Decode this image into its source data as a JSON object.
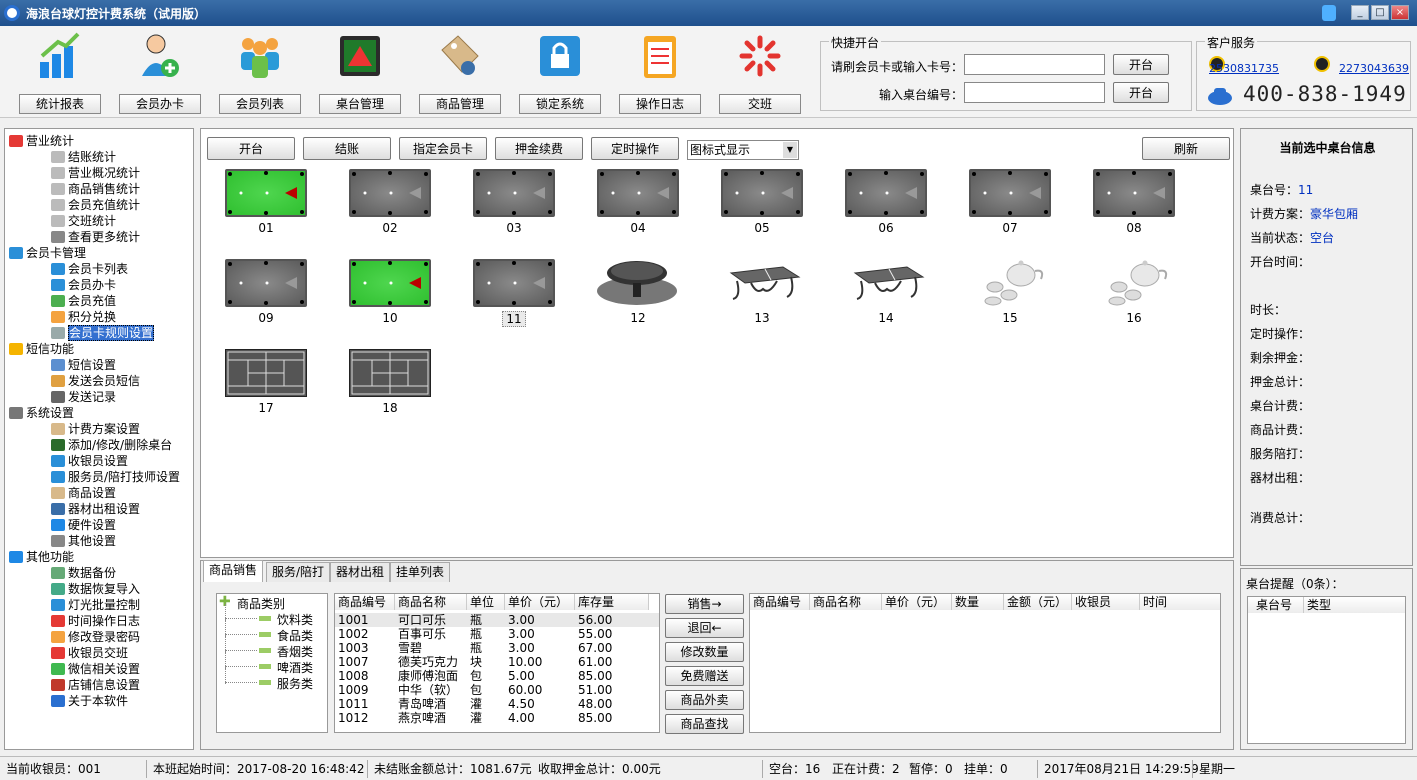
{
  "window": {
    "title": "海浪台球灯控计费系统（试用版）",
    "min": "_",
    "max": "□",
    "close": "×"
  },
  "toolbar": {
    "buttons": [
      {
        "label": "统计报表",
        "icon": "bar-chart-icon"
      },
      {
        "label": "会员办卡",
        "icon": "add-member-icon"
      },
      {
        "label": "会员列表",
        "icon": "members-icon"
      },
      {
        "label": "桌台管理",
        "icon": "billiard-rack-icon"
      },
      {
        "label": "商品管理",
        "icon": "price-tag-icon"
      },
      {
        "label": "锁定系统",
        "icon": "lock-icon"
      },
      {
        "label": "操作日志",
        "icon": "clipboard-icon"
      },
      {
        "label": "交班",
        "icon": "spinner-icon"
      }
    ]
  },
  "quick_open": {
    "title": "快捷开台",
    "card_label": "请刷会员卡或输入卡号：",
    "table_label": "输入桌台编号：",
    "open_button": "开台",
    "open_button2": "开台"
  },
  "service": {
    "title": "客户服务",
    "qq1": "2530831735",
    "qq2": "2273043639",
    "phone": "400-838-1949"
  },
  "tree": [
    {
      "label": "营业统计",
      "level": 0,
      "icon": "pie-icon"
    },
    {
      "label": "结账统计",
      "level": 1,
      "icon": "doc-icon"
    },
    {
      "label": "营业概况统计",
      "level": 1,
      "icon": "doc-icon"
    },
    {
      "label": "商品销售统计",
      "level": 1,
      "icon": "doc-icon"
    },
    {
      "label": "会员充值统计",
      "level": 1,
      "icon": "doc-icon"
    },
    {
      "label": "交班统计",
      "level": 1,
      "icon": "doc-icon"
    },
    {
      "label": "查看更多统计",
      "level": 1,
      "icon": "more-icon"
    },
    {
      "label": "会员卡管理",
      "level": 0,
      "icon": "user-icon"
    },
    {
      "label": "会员卡列表",
      "level": 1,
      "icon": "user-icon"
    },
    {
      "label": "会员办卡",
      "level": 1,
      "icon": "user-add-icon"
    },
    {
      "label": "会员充值",
      "level": 1,
      "icon": "recharge-icon"
    },
    {
      "label": "积分兑换",
      "level": 1,
      "icon": "gift-icon"
    },
    {
      "label": "会员卡规则设置",
      "level": 1,
      "icon": "rule-icon",
      "selected": true
    },
    {
      "label": "短信功能",
      "level": 0,
      "icon": "mail-icon"
    },
    {
      "label": "短信设置",
      "level": 1,
      "icon": "sms-icon"
    },
    {
      "label": "发送会员短信",
      "level": 1,
      "icon": "send-icon"
    },
    {
      "label": "发送记录",
      "level": 1,
      "icon": "list-icon"
    },
    {
      "label": "系统设置",
      "level": 0,
      "icon": "gear-icon"
    },
    {
      "label": "计费方案设置",
      "level": 1,
      "icon": "tag-icon"
    },
    {
      "label": "添加/修改/删除桌台",
      "level": 1,
      "icon": "table-icon"
    },
    {
      "label": "收银员设置",
      "level": 1,
      "icon": "user-icon"
    },
    {
      "label": "服务员/陪打技师设置",
      "level": 1,
      "icon": "user-icon"
    },
    {
      "label": "商品设置",
      "level": 1,
      "icon": "tag-icon"
    },
    {
      "label": "器材出租设置",
      "level": 1,
      "icon": "link-icon"
    },
    {
      "label": "硬件设置",
      "level": 1,
      "icon": "hardware-icon"
    },
    {
      "label": "其他设置",
      "level": 1,
      "icon": "tools-icon"
    },
    {
      "label": "其他功能",
      "level": 0,
      "icon": "cube-icon"
    },
    {
      "label": "数据备份",
      "level": 1,
      "icon": "backup-icon"
    },
    {
      "label": "数据恢复导入",
      "level": 1,
      "icon": "restore-icon"
    },
    {
      "label": "灯光批量控制",
      "level": 1,
      "icon": "bulb-icon"
    },
    {
      "label": "时间操作日志",
      "level": 1,
      "icon": "clock-icon"
    },
    {
      "label": "修改登录密码",
      "level": 1,
      "icon": "key-icon"
    },
    {
      "label": "收银员交班",
      "level": 1,
      "icon": "spinner-icon"
    },
    {
      "label": "微信相关设置",
      "level": 1,
      "icon": "wechat-icon"
    },
    {
      "label": "店铺信息设置",
      "level": 1,
      "icon": "shop-icon"
    },
    {
      "label": "关于本软件",
      "level": 1,
      "icon": "info-icon"
    }
  ],
  "actions": {
    "open": "开台",
    "checkout": "结账",
    "assign_card": "指定会员卡",
    "deposit": "押金续费",
    "timer": "定时操作",
    "view_mode": "图标式显示",
    "refresh": "刷新"
  },
  "tables": [
    {
      "no": "01",
      "type": "billiard",
      "active": true
    },
    {
      "no": "02",
      "type": "billiard"
    },
    {
      "no": "03",
      "type": "billiard"
    },
    {
      "no": "04",
      "type": "billiard"
    },
    {
      "no": "05",
      "type": "billiard"
    },
    {
      "no": "06",
      "type": "billiard"
    },
    {
      "no": "07",
      "type": "billiard"
    },
    {
      "no": "08",
      "type": "billiard"
    },
    {
      "no": "09",
      "type": "billiard"
    },
    {
      "no": "10",
      "type": "billiard",
      "active": true
    },
    {
      "no": "11",
      "type": "billiard",
      "selected": true
    },
    {
      "no": "12",
      "type": "mahjong"
    },
    {
      "no": "13",
      "type": "pingpong"
    },
    {
      "no": "14",
      "type": "pingpong"
    },
    {
      "no": "15",
      "type": "tea"
    },
    {
      "no": "16",
      "type": "tea"
    },
    {
      "no": "17",
      "type": "badminton"
    },
    {
      "no": "18",
      "type": "badminton"
    }
  ],
  "tabs": [
    "商品销售",
    "服务/陪打",
    "器材出租",
    "挂单列表"
  ],
  "categories": {
    "root": "商品类别",
    "items": [
      "饮料类",
      "食品类",
      "香烟类",
      "啤酒类",
      "服务类"
    ]
  },
  "products": {
    "headers": [
      "商品编号",
      "商品名称",
      "单位",
      "单价（元）",
      "库存量"
    ],
    "rows": [
      [
        "1001",
        "可口可乐",
        "瓶",
        "3.00",
        "56.00"
      ],
      [
        "1002",
        "百事可乐",
        "瓶",
        "3.00",
        "55.00"
      ],
      [
        "1003",
        "雪碧",
        "瓶",
        "3.00",
        "67.00"
      ],
      [
        "1007",
        "德芙巧克力",
        "块",
        "10.00",
        "61.00"
      ],
      [
        "1008",
        "康师傅泡面",
        "包",
        "5.00",
        "85.00"
      ],
      [
        "1009",
        "中华（软）",
        "包",
        "60.00",
        "51.00"
      ],
      [
        "1011",
        "青岛啤酒",
        "灌",
        "4.50",
        "48.00"
      ],
      [
        "1012",
        "燕京啤酒",
        "灌",
        "4.00",
        "85.00"
      ]
    ]
  },
  "sale_buttons": [
    "销售→",
    "退回←",
    "修改数量",
    "免费赠送",
    "商品外卖",
    "商品查找"
  ],
  "sold": {
    "headers": [
      "商品编号",
      "商品名称",
      "单价（元）",
      "数量",
      "金额（元）",
      "收银员",
      "时间"
    ]
  },
  "info": {
    "title": "当前选中桌台信息",
    "table_no_label": "桌台号：",
    "table_no": "11",
    "plan_label": "计费方案：",
    "plan": "豪华包厢",
    "state_label": "当前状态：",
    "state": "空台",
    "start_label": "开台时间：",
    "duration_label": "时长：",
    "timer_label": "定时操作：",
    "deposit_left_label": "剩余押金：",
    "deposit_total_label": "押金总计：",
    "table_fee_label": "桌台计费：",
    "goods_fee_label": "商品计费：",
    "service_label": "服务陪打：",
    "rent_label": "器材出租：",
    "total_label": "消费总计："
  },
  "remind": {
    "title": "桌台提醒（0条）：",
    "headers": [
      "桌台号",
      "类型"
    ]
  },
  "status": {
    "cashier": "当前收银员：001",
    "shift_start": "本班起始时间：2017-08-20 16:48:42",
    "unsettled": "未结账金额总计：1081.67元",
    "deposit": "收取押金总计：0.00元",
    "idle": "空台：16",
    "billing": "正在计费：2",
    "paused": "暂停：0",
    "hung": "挂单：0",
    "datetime": "2017年08月21日 14:29:59",
    "weekday": "星期一"
  },
  "colors": {
    "felt_active": "#2fbf2f",
    "felt_idle": "#5a5a5a",
    "link": "#0030c0",
    "selection": "#3470d0"
  }
}
